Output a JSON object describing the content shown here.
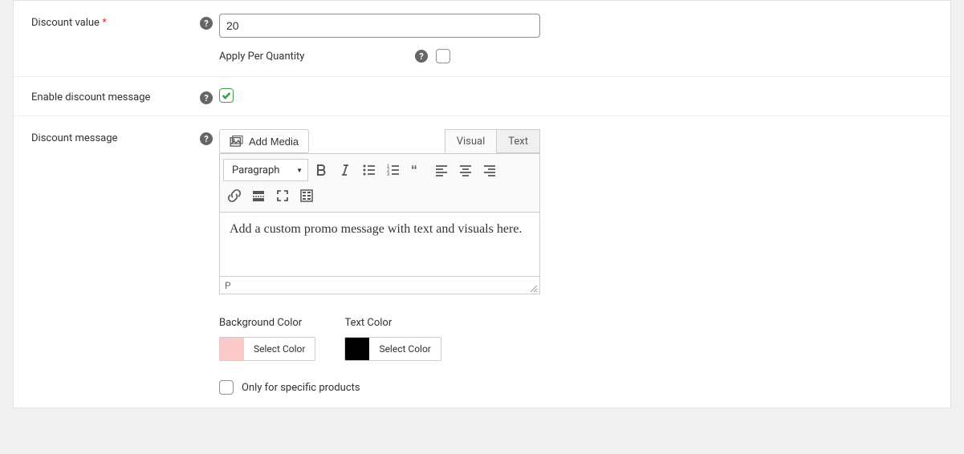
{
  "discount_value": {
    "label": "Discount value",
    "required_marker": "*",
    "value": "20",
    "apply_per_qty_label": "Apply Per Quantity",
    "apply_per_qty_checked": false
  },
  "enable_message": {
    "label": "Enable discount message",
    "checked": true
  },
  "discount_message": {
    "label": "Discount message",
    "add_media_label": "Add Media",
    "tabs": {
      "visual": "Visual",
      "text": "Text",
      "active": "visual"
    },
    "format_selected": "Paragraph",
    "content": "Add a custom promo message with text and visuals here.",
    "path_bar": "P",
    "background_color": {
      "label": "Background Color",
      "swatch": "#fcc9c9",
      "button": "Select Color"
    },
    "text_color": {
      "label": "Text Color",
      "swatch": "#000000",
      "button": "Select Color"
    },
    "only_specific_label": "Only for specific products",
    "only_specific_checked": false
  },
  "icons": {
    "help": "?",
    "dropdown": "▼"
  }
}
